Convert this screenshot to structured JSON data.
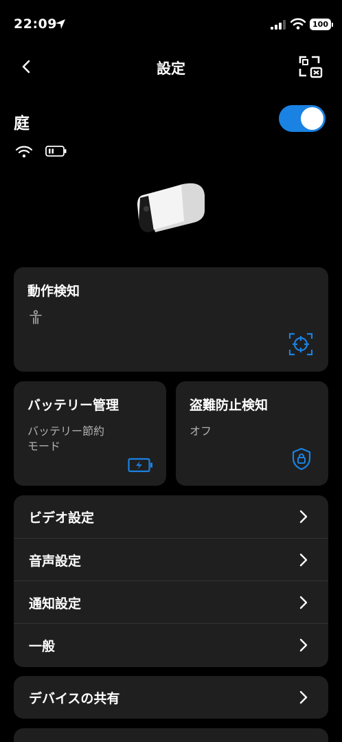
{
  "status_bar": {
    "time": "22:09",
    "battery": "100"
  },
  "nav": {
    "title": "設定"
  },
  "device": {
    "name": "庭",
    "enabled": true
  },
  "motion_card": {
    "title": "動作検知"
  },
  "battery_card": {
    "title": "バッテリー管理",
    "subtitle_line1": "バッテリー節約",
    "subtitle_line2": "モード"
  },
  "theft_card": {
    "title": "盗難防止検知",
    "subtitle": "オフ"
  },
  "settings_list": [
    {
      "label": "ビデオ設定"
    },
    {
      "label": "音声設定"
    },
    {
      "label": "通知設定"
    },
    {
      "label": "一般"
    }
  ],
  "share": {
    "label": "デバイスの共有"
  },
  "colors": {
    "accent": "#1a82e2",
    "card": "#1f1f1f",
    "background": "#000000"
  }
}
